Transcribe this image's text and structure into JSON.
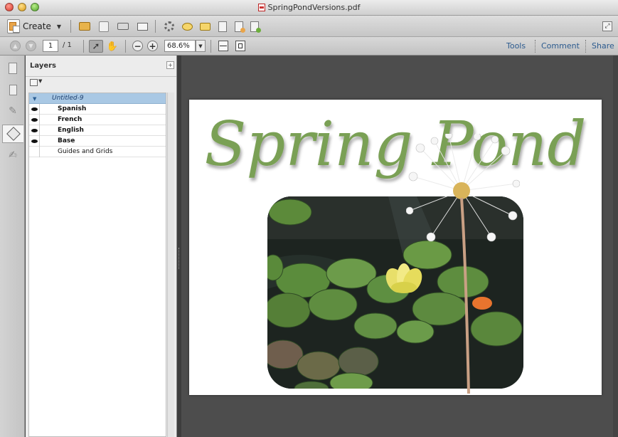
{
  "window": {
    "title": "SpringPondVersions.pdf"
  },
  "toolbar": {
    "create_label": "Create",
    "icons": [
      "open-icon",
      "save-icon",
      "print-icon",
      "email-icon",
      "gear-icon",
      "comment-icon",
      "highlight-icon",
      "document-icon",
      "export-icon",
      "sign-icon"
    ]
  },
  "navbar": {
    "page_current": "1",
    "page_total": "/ 1",
    "zoom_value": "68.6%",
    "tools_label": "Tools",
    "comment_label": "Comment",
    "share_label": "Share"
  },
  "layers_panel": {
    "title": "Layers",
    "parent_layer": "Untitled-9",
    "layers": [
      {
        "name": "Spanish",
        "visible": true
      },
      {
        "name": "French",
        "visible": true
      },
      {
        "name": "English",
        "visible": true
      },
      {
        "name": "Base",
        "visible": true
      },
      {
        "name": "Guides and Grids",
        "visible": false
      }
    ]
  },
  "document": {
    "title_text": "Spring Pond",
    "title_color": "#7aa055"
  }
}
